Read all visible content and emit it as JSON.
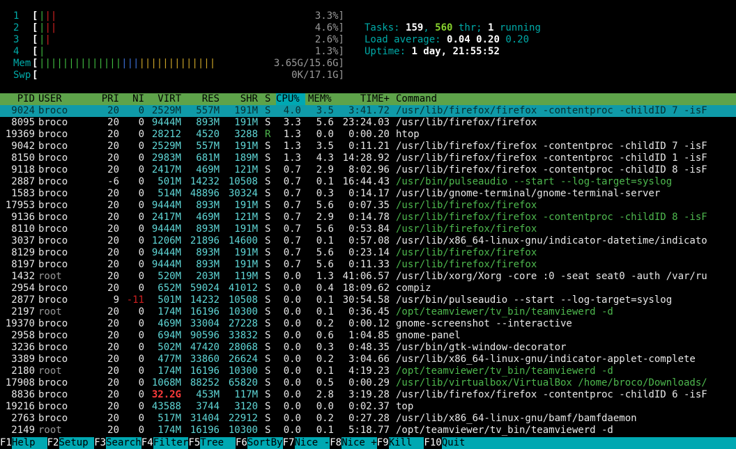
{
  "meters": {
    "cpus": [
      {
        "id": "1",
        "bar": "|||",
        "value": "3.3%]"
      },
      {
        "id": "2",
        "bar": "|||",
        "value": "4.6%]"
      },
      {
        "id": "3",
        "bar": "||",
        "value": "2.6%]"
      },
      {
        "id": "4",
        "bar": "|",
        "value": "1.3%]"
      }
    ],
    "mem": {
      "label": "Mem",
      "bar": "||||||||||||||||||||||||||||||",
      "value": "3.65G/15.6G]"
    },
    "swp": {
      "label": "Swp",
      "bar": "",
      "value": "0K/17.1G]"
    }
  },
  "summary": {
    "tasks_label": "Tasks: ",
    "tasks": "159",
    "thr_sep": ", ",
    "threads": "560",
    "thr_label": " thr; ",
    "running": "1",
    "running_label": " running",
    "load_label": "Load average: ",
    "load1": "0.04",
    "load5": "0.20",
    "load15": "0.20",
    "uptime_label": "Uptime: ",
    "uptime": "1 day, 21:55:52"
  },
  "columns": {
    "pid": "PID",
    "user": "USER",
    "pri": "PRI",
    "ni": "NI",
    "virt": "VIRT",
    "res": "RES",
    "shr": "SHR",
    "s": "S",
    "cpu": "CPU%",
    "mem": "MEM%",
    "time": "TIME+",
    "cmd": "Command"
  },
  "processes": [
    {
      "pid": "9024",
      "user": "broco",
      "pri": "20",
      "ni": "0",
      "virt": "2529M",
      "res": "557M",
      "shr": "191M",
      "s": "S",
      "cpu": "4.0",
      "mem": "3.5",
      "time": "3:41.72",
      "cmd": "/usr/lib/firefox/firefox -contentproc -childID 7 -isF",
      "thread": true,
      "selected": true
    },
    {
      "pid": "8095",
      "user": "broco",
      "pri": "20",
      "ni": "0",
      "virt": "9444M",
      "res": "893M",
      "shr": "191M",
      "s": "S",
      "cpu": "3.3",
      "mem": "5.6",
      "time": "23:24.03",
      "cmd": "/usr/lib/firefox/firefox",
      "thread": false
    },
    {
      "pid": "19369",
      "user": "broco",
      "pri": "20",
      "ni": "0",
      "virt": "28212",
      "res": "4520",
      "shr": "3288",
      "s": "R",
      "cpu": "1.3",
      "mem": "0.0",
      "time": "0:00.20",
      "cmd": "htop",
      "thread": false
    },
    {
      "pid": "9042",
      "user": "broco",
      "pri": "20",
      "ni": "0",
      "virt": "2529M",
      "res": "557M",
      "shr": "191M",
      "s": "S",
      "cpu": "1.3",
      "mem": "3.5",
      "time": "0:11.21",
      "cmd": "/usr/lib/firefox/firefox -contentproc -childID 7 -isF",
      "thread": false
    },
    {
      "pid": "8150",
      "user": "broco",
      "pri": "20",
      "ni": "0",
      "virt": "2983M",
      "res": "681M",
      "shr": "189M",
      "s": "S",
      "cpu": "1.3",
      "mem": "4.3",
      "time": "14:28.92",
      "cmd": "/usr/lib/firefox/firefox -contentproc -childID 1 -isF",
      "thread": false
    },
    {
      "pid": "9118",
      "user": "broco",
      "pri": "20",
      "ni": "0",
      "virt": "2417M",
      "res": "469M",
      "shr": "121M",
      "s": "S",
      "cpu": "0.7",
      "mem": "2.9",
      "time": "8:02.96",
      "cmd": "/usr/lib/firefox/firefox -contentproc -childID 8 -isF",
      "thread": false
    },
    {
      "pid": "2887",
      "user": "broco",
      "pri": "-6",
      "ni": "0",
      "virt": "501M",
      "res": "14232",
      "shr": "10508",
      "s": "S",
      "cpu": "0.7",
      "mem": "0.1",
      "time": "16:44.43",
      "cmd": "/usr/bin/pulseaudio --start --log-target=syslog",
      "thread": true
    },
    {
      "pid": "1583",
      "user": "broco",
      "pri": "20",
      "ni": "0",
      "virt": "514M",
      "res": "48896",
      "shr": "30324",
      "s": "S",
      "cpu": "0.7",
      "mem": "0.3",
      "time": "0:14.17",
      "cmd": "/usr/lib/gnome-terminal/gnome-terminal-server",
      "thread": false
    },
    {
      "pid": "17953",
      "user": "broco",
      "pri": "20",
      "ni": "0",
      "virt": "9444M",
      "res": "893M",
      "shr": "191M",
      "s": "S",
      "cpu": "0.7",
      "mem": "5.6",
      "time": "0:07.35",
      "cmd": "/usr/lib/firefox/firefox",
      "thread": true
    },
    {
      "pid": "9136",
      "user": "broco",
      "pri": "20",
      "ni": "0",
      "virt": "2417M",
      "res": "469M",
      "shr": "121M",
      "s": "S",
      "cpu": "0.7",
      "mem": "2.9",
      "time": "0:14.78",
      "cmd": "/usr/lib/firefox/firefox -contentproc -childID 8 -isF",
      "thread": true
    },
    {
      "pid": "8110",
      "user": "broco",
      "pri": "20",
      "ni": "0",
      "virt": "9444M",
      "res": "893M",
      "shr": "191M",
      "s": "S",
      "cpu": "0.7",
      "mem": "5.6",
      "time": "0:53.84",
      "cmd": "/usr/lib/firefox/firefox",
      "thread": true
    },
    {
      "pid": "3037",
      "user": "broco",
      "pri": "20",
      "ni": "0",
      "virt": "1206M",
      "res": "21896",
      "shr": "14600",
      "s": "S",
      "cpu": "0.7",
      "mem": "0.1",
      "time": "0:57.08",
      "cmd": "/usr/lib/x86_64-linux-gnu/indicator-datetime/indicato",
      "thread": false
    },
    {
      "pid": "8129",
      "user": "broco",
      "pri": "20",
      "ni": "0",
      "virt": "9444M",
      "res": "893M",
      "shr": "191M",
      "s": "S",
      "cpu": "0.7",
      "mem": "5.6",
      "time": "0:23.14",
      "cmd": "/usr/lib/firefox/firefox",
      "thread": true
    },
    {
      "pid": "8197",
      "user": "broco",
      "pri": "20",
      "ni": "0",
      "virt": "9444M",
      "res": "893M",
      "shr": "191M",
      "s": "S",
      "cpu": "0.7",
      "mem": "5.6",
      "time": "0:11.33",
      "cmd": "/usr/lib/firefox/firefox",
      "thread": true
    },
    {
      "pid": "1432",
      "user": "root",
      "pri": "20",
      "ni": "0",
      "virt": "520M",
      "res": "203M",
      "shr": "119M",
      "s": "S",
      "cpu": "0.0",
      "mem": "1.3",
      "time": "41:06.57",
      "cmd": "/usr/lib/xorg/Xorg -core :0 -seat seat0 -auth /var/ru",
      "thread": false
    },
    {
      "pid": "2954",
      "user": "broco",
      "pri": "20",
      "ni": "0",
      "virt": "652M",
      "res": "59024",
      "shr": "41012",
      "s": "S",
      "cpu": "0.0",
      "mem": "0.4",
      "time": "18:09.62",
      "cmd": "compiz",
      "thread": false
    },
    {
      "pid": "2877",
      "user": "broco",
      "pri": "9",
      "ni": "-11",
      "virt": "501M",
      "res": "14232",
      "shr": "10508",
      "s": "S",
      "cpu": "0.0",
      "mem": "0.1",
      "time": "30:54.58",
      "cmd": "/usr/bin/pulseaudio --start --log-target=syslog",
      "thread": false
    },
    {
      "pid": "2197",
      "user": "root",
      "pri": "20",
      "ni": "0",
      "virt": "174M",
      "res": "16196",
      "shr": "10300",
      "s": "S",
      "cpu": "0.0",
      "mem": "0.1",
      "time": "0:36.45",
      "cmd": "/opt/teamviewer/tv_bin/teamviewerd -d",
      "thread": true
    },
    {
      "pid": "19370",
      "user": "broco",
      "pri": "20",
      "ni": "0",
      "virt": "469M",
      "res": "33004",
      "shr": "27228",
      "s": "S",
      "cpu": "0.0",
      "mem": "0.2",
      "time": "0:00.12",
      "cmd": "gnome-screenshot --interactive",
      "thread": false
    },
    {
      "pid": "2958",
      "user": "broco",
      "pri": "20",
      "ni": "0",
      "virt": "694M",
      "res": "90596",
      "shr": "33832",
      "s": "S",
      "cpu": "0.0",
      "mem": "0.6",
      "time": "1:04.85",
      "cmd": "gnome-panel",
      "thread": false
    },
    {
      "pid": "3236",
      "user": "broco",
      "pri": "20",
      "ni": "0",
      "virt": "502M",
      "res": "47420",
      "shr": "28068",
      "s": "S",
      "cpu": "0.0",
      "mem": "0.3",
      "time": "0:48.35",
      "cmd": "/usr/bin/gtk-window-decorator",
      "thread": false
    },
    {
      "pid": "3389",
      "user": "broco",
      "pri": "20",
      "ni": "0",
      "virt": "477M",
      "res": "33860",
      "shr": "26624",
      "s": "S",
      "cpu": "0.0",
      "mem": "0.2",
      "time": "3:04.66",
      "cmd": "/usr/lib/x86_64-linux-gnu/indicator-applet-complete",
      "thread": false
    },
    {
      "pid": "2180",
      "user": "root",
      "pri": "20",
      "ni": "0",
      "virt": "174M",
      "res": "16196",
      "shr": "10300",
      "s": "S",
      "cpu": "0.0",
      "mem": "0.1",
      "time": "4:19.23",
      "cmd": "/opt/teamviewer/tv_bin/teamviewerd -d",
      "thread": true
    },
    {
      "pid": "17908",
      "user": "broco",
      "pri": "20",
      "ni": "0",
      "virt": "1068M",
      "res": "88252",
      "shr": "65820",
      "s": "S",
      "cpu": "0.0",
      "mem": "0.5",
      "time": "0:00.29",
      "cmd": "/usr/lib/virtualbox/VirtualBox /home/broco/Downloads/",
      "thread": true
    },
    {
      "pid": "8836",
      "user": "broco",
      "pri": "20",
      "ni": "0",
      "virt": "32.2G",
      "res": "453M",
      "shr": "117M",
      "s": "S",
      "cpu": "0.0",
      "mem": "2.8",
      "time": "3:19.28",
      "cmd": "/usr/lib/firefox/firefox -contentproc -childID 6 -isF",
      "thread": false,
      "virt_big": true
    },
    {
      "pid": "19216",
      "user": "broco",
      "pri": "20",
      "ni": "0",
      "virt": "43588",
      "res": "3744",
      "shr": "3120",
      "s": "S",
      "cpu": "0.0",
      "mem": "0.0",
      "time": "0:02.37",
      "cmd": "top",
      "thread": false
    },
    {
      "pid": "2763",
      "user": "broco",
      "pri": "20",
      "ni": "0",
      "virt": "517M",
      "res": "31404",
      "shr": "22912",
      "s": "S",
      "cpu": "0.0",
      "mem": "0.2",
      "time": "0:27.28",
      "cmd": "/usr/lib/x86_64-linux-gnu/bamf/bamfdaemon",
      "thread": false
    },
    {
      "pid": "2149",
      "user": "root",
      "pri": "20",
      "ni": "0",
      "virt": "174M",
      "res": "16196",
      "shr": "10300",
      "s": "S",
      "cpu": "0.0",
      "mem": "0.1",
      "time": "5:18.77",
      "cmd": "/opt/teamviewer/tv_bin/teamviewerd -d",
      "thread": false
    }
  ],
  "footer": [
    {
      "key": "F1",
      "label": "Help  "
    },
    {
      "key": "F2",
      "label": "Setup "
    },
    {
      "key": "F3",
      "label": "Search"
    },
    {
      "key": "F4",
      "label": "Filter"
    },
    {
      "key": "F5",
      "label": "Tree  "
    },
    {
      "key": "F6",
      "label": "SortBy"
    },
    {
      "key": "F7",
      "label": "Nice -"
    },
    {
      "key": "F8",
      "label": "Nice +"
    },
    {
      "key": "F9",
      "label": "Kill  "
    },
    {
      "key": "F10",
      "label": "Quit"
    }
  ],
  "colors": {
    "header_bg": "#5ea34a",
    "selected_bg": "#0f9aa8",
    "sorted_col": "#00a8b2",
    "footer_label_bg": "#00a8b2"
  }
}
